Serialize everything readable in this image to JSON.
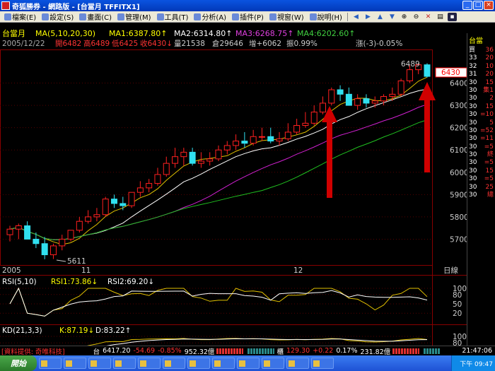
{
  "window": {
    "title": "奇狐勝券 - 網路版 - [台當月 TFFITX1]"
  },
  "menu": {
    "items": [
      "檔案(E)",
      "設定(S)",
      "畫面(C)",
      "管理(M)",
      "工具(T)",
      "分析(A)",
      "插件(P)",
      "視窗(W)",
      "說明(H)"
    ]
  },
  "chart_header": {
    "line1_label": "台當月",
    "ma_params": "MA(5,10,20,30)",
    "ma1": "MA1:6387.80↑",
    "ma2": "MA2:6314.80↑",
    "ma3": "MA3:6268.75↑",
    "ma4": "MA4:6202.60↑",
    "date": "2005/12/22",
    "open": "開6482",
    "high": "高6489",
    "low": "低6425",
    "close": "收6430↓",
    "vol": "量21538",
    "oi": "倉29646",
    "chg": "增+6062",
    "amp": "振0.99%",
    "pct": "漲(-3)-0.05%"
  },
  "price_axis": {
    "ticks": [
      "6400",
      "6300",
      "6200",
      "6100",
      "6000",
      "5900",
      "5800",
      "5700"
    ],
    "current": "6430"
  },
  "annotations": {
    "high": "6489",
    "low": "5611"
  },
  "date_axis": {
    "labels": [
      "2005",
      "11",
      "12"
    ],
    "period": "日線"
  },
  "rsi": {
    "header": "RSI(5,10)",
    "rsi1": "RSI1:73.86↓",
    "rsi2": "RSI2:69.20↓",
    "ticks": [
      "100",
      "80",
      "50",
      "20"
    ]
  },
  "kd": {
    "header": "KD(21,3,3)",
    "k": "K:87.19↓",
    "d": "D:83.22↑",
    "ticks": [
      "100",
      "80",
      "50",
      "20"
    ]
  },
  "right_panel": {
    "header": "台當",
    "rows": [
      [
        "買",
        "36"
      ],
      [
        "33",
        "20"
      ],
      [
        "32",
        "10"
      ],
      [
        "31",
        "20"
      ],
      [
        "30",
        "15"
      ],
      [
        "30",
        "集1"
      ],
      [
        "30",
        "2"
      ],
      [
        "30",
        "15"
      ],
      [
        "30",
        "=10"
      ],
      [
        "30",
        "5"
      ],
      [
        "30",
        "=52"
      ],
      [
        "30",
        "=11"
      ],
      [
        "30",
        "=5"
      ],
      [
        "30",
        "終"
      ],
      [
        "30",
        "=5"
      ],
      [
        "30",
        "15"
      ],
      [
        "30",
        "=5"
      ],
      [
        "30",
        "25"
      ],
      [
        "30",
        "總"
      ]
    ]
  },
  "status": {
    "provider": "[資料提供: 奇唯科技]",
    "idx1_name": "台",
    "idx1_value": "6417.20",
    "idx1_change": "-54.69",
    "idx1_pct": "-0.85%",
    "idx1_amount": "952.32億",
    "idx2_name": "櫃",
    "idx2_value": "129.30",
    "idx2_change": "+0.22",
    "idx2_pct": "0.17%",
    "idx2_amount": "231.82億",
    "time": "21:47:06"
  },
  "taskbar": {
    "start": "開始",
    "clock": "下午 09:47"
  },
  "chart_data": {
    "type": "candlestick",
    "x": [
      "2005/10/17",
      "2005/10/18",
      "2005/10/19",
      "2005/10/20",
      "2005/10/21",
      "2005/10/24",
      "2005/10/25",
      "2005/10/26",
      "2005/10/27",
      "2005/10/28",
      "2005/10/31",
      "2005/11/01",
      "2005/11/02",
      "2005/11/03",
      "2005/11/04",
      "2005/11/07",
      "2005/11/08",
      "2005/11/09",
      "2005/11/10",
      "2005/11/11",
      "2005/11/14",
      "2005/11/15",
      "2005/11/16",
      "2005/11/17",
      "2005/11/18",
      "2005/11/21",
      "2005/11/22",
      "2005/11/23",
      "2005/11/24",
      "2005/11/25",
      "2005/11/28",
      "2005/11/29",
      "2005/11/30",
      "2005/12/01",
      "2005/12/02",
      "2005/12/05",
      "2005/12/06",
      "2005/12/07",
      "2005/12/08",
      "2005/12/09",
      "2005/12/12",
      "2005/12/13",
      "2005/12/14",
      "2005/12/15",
      "2005/12/16",
      "2005/12/19",
      "2005/12/20",
      "2005/12/21",
      "2005/12/22"
    ],
    "open": [
      5720,
      5745,
      5760,
      5700,
      5680,
      5630,
      5670,
      5700,
      5740,
      5780,
      5800,
      5810,
      5880,
      5860,
      5850,
      5910,
      5930,
      5950,
      5990,
      6040,
      6070,
      6090,
      6040,
      6050,
      6060,
      6100,
      6120,
      6140,
      6130,
      6160,
      6160,
      6140,
      6150,
      6180,
      6210,
      6220,
      6270,
      6310,
      6370,
      6350,
      6300,
      6330,
      6310,
      6320,
      6340,
      6350,
      6410,
      6460,
      6482
    ],
    "high": [
      5760,
      5770,
      5780,
      5730,
      5710,
      5680,
      5720,
      5740,
      5800,
      5830,
      5840,
      5890,
      5900,
      5890,
      5900,
      5960,
      5970,
      6020,
      6070,
      6110,
      6110,
      6110,
      6090,
      6090,
      6120,
      6140,
      6170,
      6180,
      6190,
      6200,
      6200,
      6180,
      6220,
      6240,
      6270,
      6300,
      6340,
      6380,
      6390,
      6380,
      6350,
      6350,
      6340,
      6350,
      6380,
      6420,
      6480,
      6489,
      6489
    ],
    "low": [
      5690,
      5700,
      5700,
      5660,
      5610,
      5611,
      5650,
      5690,
      5730,
      5770,
      5780,
      5800,
      5840,
      5830,
      5840,
      5890,
      5910,
      5940,
      5980,
      6020,
      6030,
      6030,
      6020,
      6030,
      6050,
      6080,
      6100,
      6110,
      6120,
      6140,
      6130,
      6120,
      6140,
      6170,
      6200,
      6210,
      6260,
      6300,
      6320,
      6300,
      6280,
      6290,
      6290,
      6300,
      6320,
      6340,
      6400,
      6440,
      6425
    ],
    "close": [
      5745,
      5760,
      5700,
      5680,
      5630,
      5670,
      5700,
      5740,
      5780,
      5800,
      5810,
      5880,
      5860,
      5850,
      5910,
      5930,
      5950,
      5990,
      6040,
      6070,
      6090,
      6040,
      6050,
      6060,
      6100,
      6120,
      6140,
      6130,
      6160,
      6160,
      6140,
      6150,
      6180,
      6210,
      6220,
      6270,
      6310,
      6370,
      6350,
      6300,
      6330,
      6310,
      6320,
      6340,
      6350,
      6410,
      6460,
      6482,
      6430
    ],
    "ylim": [
      5600,
      6500
    ]
  }
}
